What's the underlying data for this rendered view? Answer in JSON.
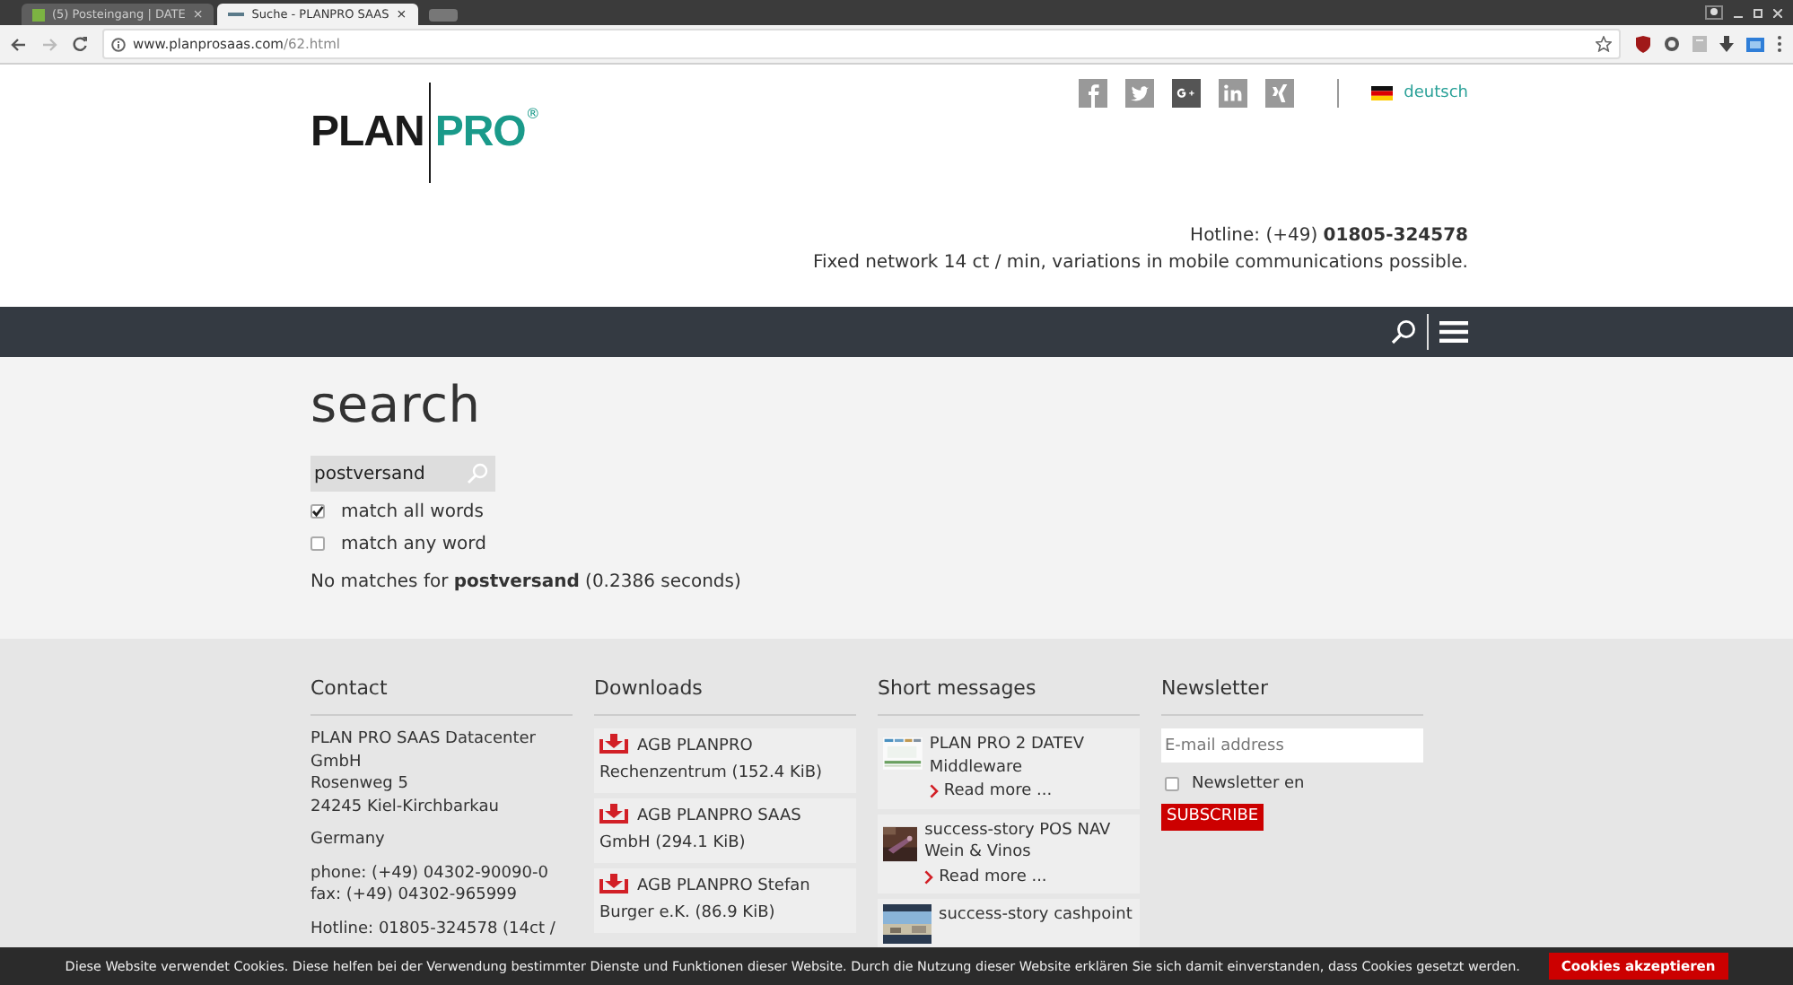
{
  "browser": {
    "tabs": [
      {
        "title": "(5) Posteingang | DATE",
        "close": "×",
        "selected": false
      },
      {
        "title": "Suche - PLANPRO SAAS",
        "close": "×",
        "selected": true
      }
    ],
    "url": {
      "host": "www.planprosaas.com",
      "path": "/62.html"
    }
  },
  "header": {
    "logo": {
      "left": "PLAN",
      "right": "PRO",
      "mark": "®"
    },
    "language": "deutsch",
    "hotline_label": "Hotline: (+49)",
    "hotline_number": "01805-324578",
    "hotline_note": "Fixed network 14 ct / min, variations in mobile communications possible."
  },
  "search": {
    "title": "search",
    "query": "postversand",
    "options": [
      {
        "label": "match all words",
        "checked": true
      },
      {
        "label": "match any word",
        "checked": false
      }
    ],
    "result": "No matches for **postversand** (0.2386 seconds)"
  },
  "footer": {
    "contact": {
      "heading": "Contact",
      "paragraphs": [
        [
          "PLAN PRO SAAS Datacenter GmbH",
          "Rosenweg 5",
          "24245 Kiel-Kirchbarkau"
        ],
        [
          "Germany"
        ],
        [
          "phone: (+49) 04302-90090-0",
          "fax: (+49) 04302-965999"
        ],
        [
          "Hotline: 01805-324578 (14ct /"
        ]
      ]
    },
    "downloads": {
      "heading": "Downloads",
      "items": [
        "AGB PLANPRO Rechenzentrum (152.4 KiB)",
        "AGB PLANPRO SAAS GmbH (294.1 KiB)",
        "AGB PLANPRO Stefan Burger e.K. (86.9 KiB)"
      ]
    },
    "short_messages": {
      "heading": "Short messages",
      "items": [
        {
          "title": "PLAN PRO 2 DATEV Middleware",
          "link": "Read more ..."
        },
        {
          "title": "success-story POS NAV Wein & Vinos",
          "link": "Read more ..."
        },
        {
          "title": "success-story cashpoint"
        }
      ]
    },
    "newsletter": {
      "heading": "Newsletter",
      "placeholder": "E-mail address",
      "option": {
        "label": "Newsletter en",
        "checked": false
      },
      "button": "SUBSCRIBE"
    }
  },
  "cookie": {
    "text": "Diese Website verwendet Cookies. Diese helfen bei der Verwendung bestimmter Dienste und Funktionen dieser Website. Durch die Nutzung dieser Website erklären Sie sich damit einverstanden, dass Cookies gesetzt werden.",
    "button": "Cookies akzeptieren"
  }
}
